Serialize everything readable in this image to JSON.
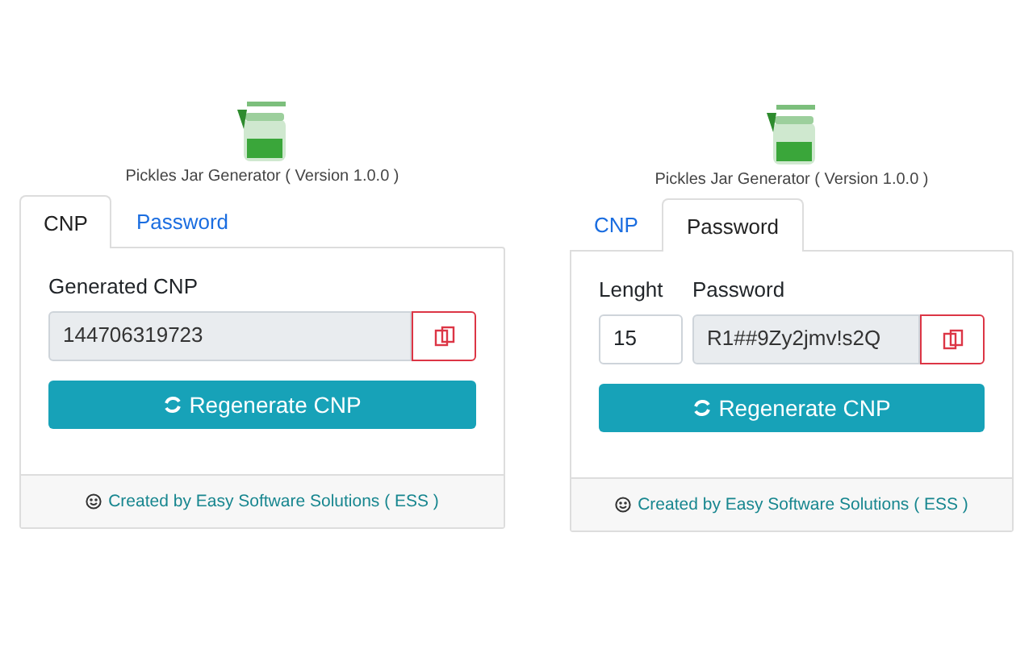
{
  "panels": [
    {
      "kind": "cnp",
      "title": "Pickles Jar Generator ( Version 1.0.0 )",
      "tabs": [
        {
          "label": "CNP",
          "selected": true
        },
        {
          "label": "Password",
          "selected": false
        }
      ],
      "field_label": "Generated CNP",
      "value": "144706319723",
      "button": "Regenerate CNP",
      "footer": "Created by Easy Software Solutions ( ESS )"
    },
    {
      "kind": "password",
      "title": "Pickles Jar Generator ( Version 1.0.0 )",
      "tabs": [
        {
          "label": "CNP",
          "selected": false
        },
        {
          "label": "Password",
          "selected": true
        }
      ],
      "length_label": "Lenght",
      "length_value": "15",
      "field_label": "Password",
      "value": "R1##9Zy2jmv!s2Q",
      "button": "Regenerate CNP",
      "footer": "Created by Easy Software Solutions ( ESS )"
    }
  ]
}
